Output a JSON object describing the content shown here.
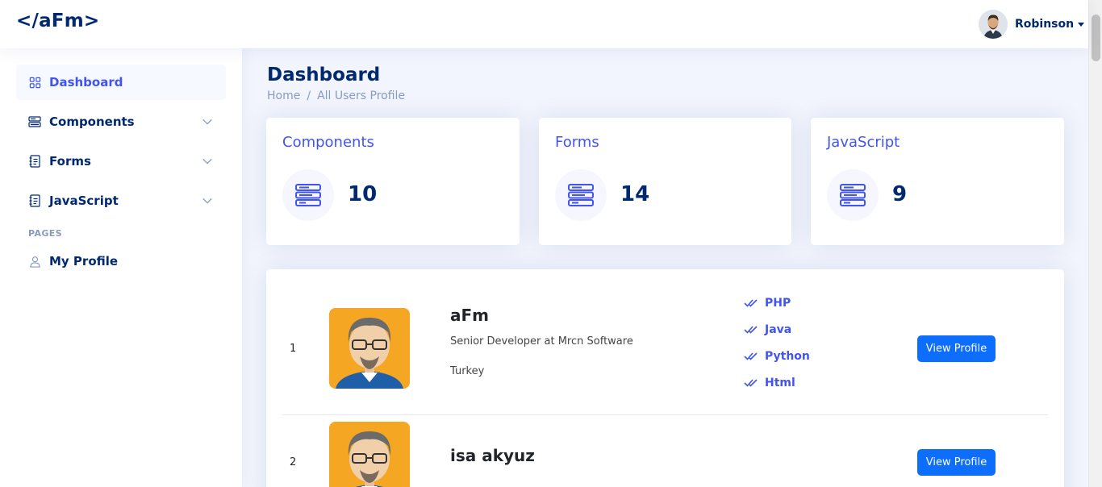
{
  "header": {
    "logo": "</aFm>",
    "user_name": "Robinson"
  },
  "sidebar": {
    "items": [
      {
        "label": "Dashboard",
        "icon": "grid-icon",
        "active": true
      },
      {
        "label": "Components",
        "icon": "menu-button-wide-icon"
      },
      {
        "label": "Forms",
        "icon": "journal-text-icon"
      },
      {
        "label": "JavaScript",
        "icon": "journal-text-icon"
      }
    ],
    "pages_heading": "PAGES",
    "pages": [
      {
        "label": "My Profile",
        "icon": "person-icon"
      }
    ]
  },
  "main": {
    "title": "Dashboard",
    "breadcrumb": [
      "Home",
      "All Users Profile"
    ],
    "breadcrumb_sep": "/",
    "stats": [
      {
        "title": "Components",
        "value": "10"
      },
      {
        "title": "Forms",
        "value": "14"
      },
      {
        "title": "JavaScript",
        "value": "9"
      }
    ],
    "users": [
      {
        "index": "1",
        "name": "aFm",
        "role": "Senior Developer at Mrcn Software",
        "country": "Turkey",
        "skills": [
          "PHP",
          "Java",
          "Python",
          "Html"
        ],
        "button": "View Profile"
      },
      {
        "index": "2",
        "name": "isa akyuz",
        "button": "View Profile"
      }
    ]
  },
  "colors": {
    "primary": "#4154f1",
    "navy": "#012970",
    "button": "#0d6efd",
    "background": "#f2f5fd"
  }
}
